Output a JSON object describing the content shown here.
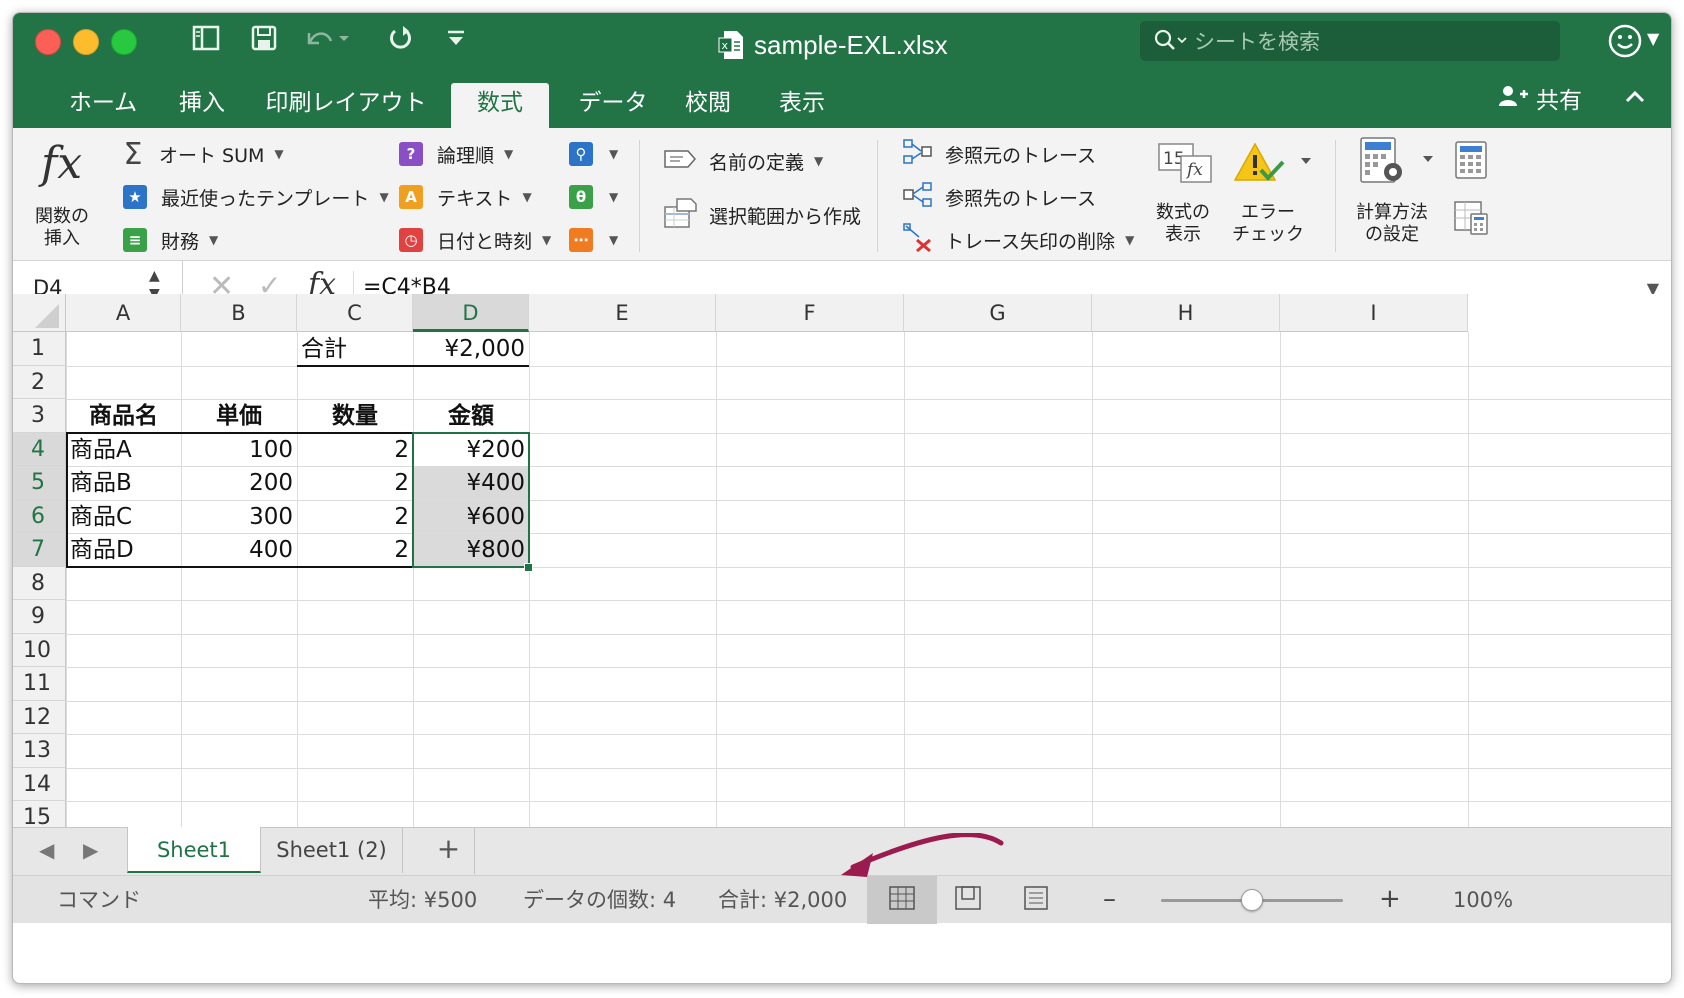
{
  "window": {
    "title": "sample-EXL.xlsx",
    "search_placeholder": "シートを検索"
  },
  "tabs": [
    {
      "label": "ホーム"
    },
    {
      "label": "挿入"
    },
    {
      "label": "印刷レイアウト"
    },
    {
      "label": "数式"
    },
    {
      "label": "データ"
    },
    {
      "label": "校閲"
    },
    {
      "label": "表示"
    }
  ],
  "share_label": "共有",
  "ribbon": {
    "insert_function": "関数の\n挿入",
    "autosum": "オート SUM",
    "recent": "最近使ったテンプレート",
    "financial": "財務",
    "logical": "論理順",
    "text": "テキスト",
    "datetime": "日付と時刻",
    "define_name": "名前の定義",
    "create_from_selection": "選択範囲から作成",
    "trace_precedents": "参照元のトレース",
    "trace_dependents": "参照先のトレース",
    "remove_arrows": "トレース矢印の削除",
    "show_formulas": "数式の\n表示",
    "show_formulas_icon_text": "15",
    "error_check": "エラー\nチェック",
    "calc_options": "計算方法\nの設定"
  },
  "formula_bar": {
    "name_box": "D4",
    "formula": "=C4*B4"
  },
  "columns": [
    "A",
    "B",
    "C",
    "D",
    "E",
    "F",
    "G",
    "H",
    "I"
  ],
  "rows": [
    "1",
    "2",
    "3",
    "4",
    "5",
    "6",
    "7",
    "8",
    "9",
    "10",
    "11",
    "12",
    "13",
    "14",
    "15"
  ],
  "cells": {
    "C1": "合計",
    "D1": "¥2,000",
    "A3": "商品名",
    "B3": "単価",
    "C3": "数量",
    "D3": "金額",
    "A4": "商品A",
    "B4": "100",
    "C4": "2",
    "D4": "¥200",
    "A5": "商品B",
    "B5": "200",
    "C5": "2",
    "D5": "¥400",
    "A6": "商品C",
    "B6": "300",
    "C6": "2",
    "D6": "¥600",
    "A7": "商品D",
    "B7": "400",
    "C7": "2",
    "D7": "¥800"
  },
  "sheets": [
    {
      "label": "Sheet1",
      "active": true
    },
    {
      "label": "Sheet1 (2)",
      "active": false
    }
  ],
  "status": {
    "mode": "コマンド",
    "average": "平均: ¥500",
    "count": "データの個数: 4",
    "sum": "合計: ¥2,000",
    "zoom": "100%"
  },
  "zoom_fraction": 0.5,
  "colors": {
    "accent": "#227447",
    "annotation_arrow": "#9b1b4e"
  }
}
